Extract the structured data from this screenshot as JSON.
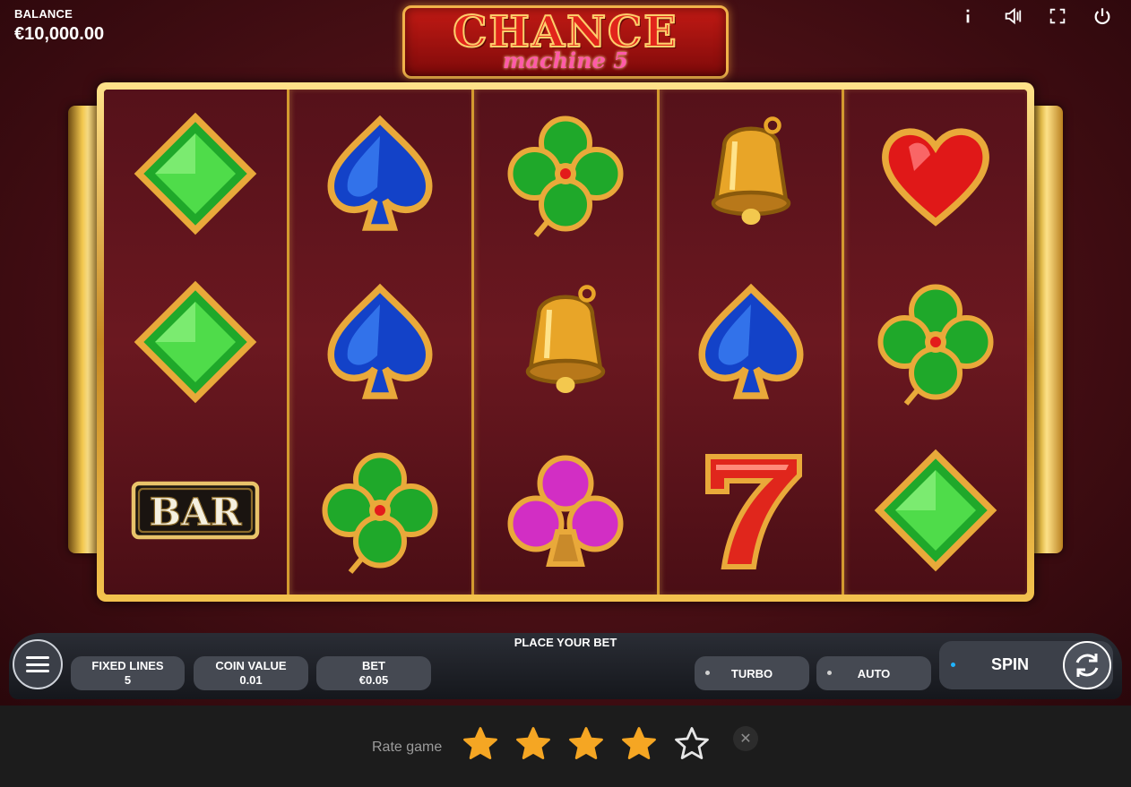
{
  "balance": {
    "label": "BALANCE",
    "value": "€10,000.00"
  },
  "logo": {
    "line1": "CHANCE",
    "line2": "machine 5"
  },
  "top_icons": [
    "info-icon",
    "sound-icon",
    "fullscreen-icon",
    "power-icon"
  ],
  "reels": [
    [
      "diamond-green",
      "diamond-green",
      "bar"
    ],
    [
      "spade-blue",
      "spade-blue",
      "clover-green"
    ],
    [
      "clover-green",
      "bell-gold",
      "club-pink"
    ],
    [
      "bell-gold",
      "spade-blue",
      "seven-red"
    ],
    [
      "heart-red",
      "clover-green",
      "diamond-green"
    ]
  ],
  "bar_symbol_text": "BAR",
  "controls": {
    "place_bet": "PLACE YOUR BET",
    "fixed_lines_label": "FIXED LINES",
    "fixed_lines_value": "5",
    "coin_value_label": "COIN VALUE",
    "coin_value_value": "0.01",
    "bet_label": "BET",
    "bet_value": "€0.05",
    "turbo_label": "TURBO",
    "auto_label": "AUTO",
    "spin_label": "SPIN"
  },
  "rating": {
    "label": "Rate game",
    "value": 4,
    "max": 5,
    "close_symbol": "✕"
  },
  "colors": {
    "background": "#4d1016",
    "gold": "#f3c84e",
    "star": "#f5a623"
  }
}
